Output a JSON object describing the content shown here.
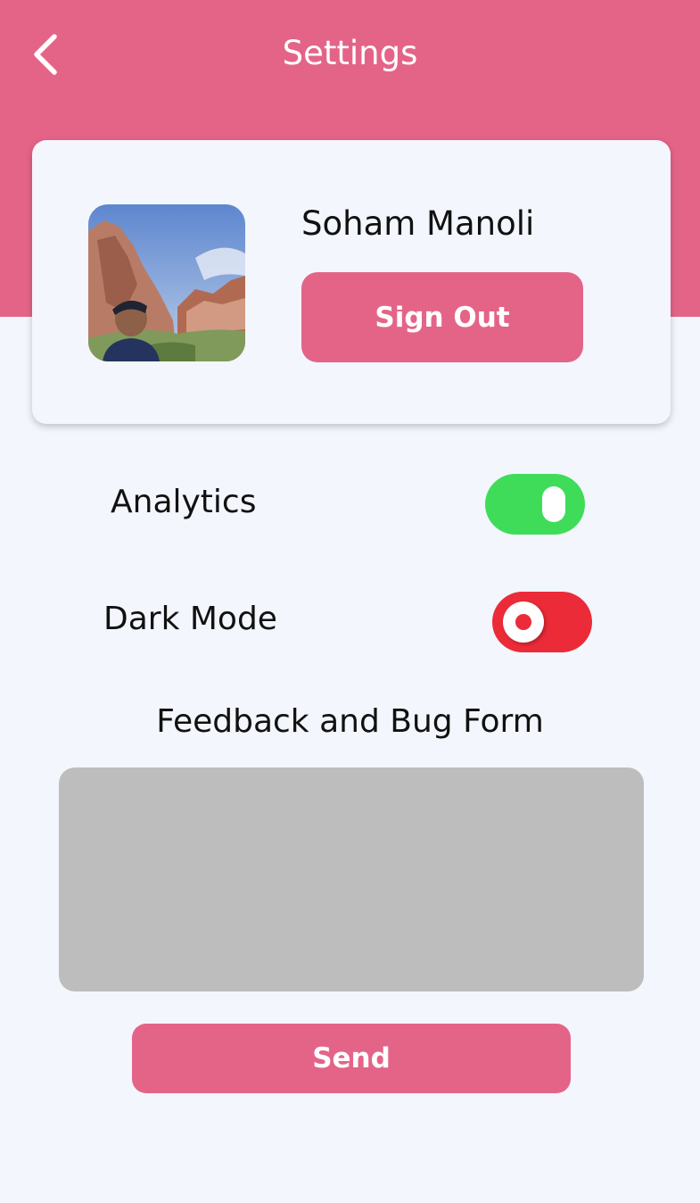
{
  "header": {
    "title": "Settings",
    "back_icon": "chevron-left-icon",
    "color": "#e46488"
  },
  "profile": {
    "name": "Soham Manoli",
    "sign_out_label": "Sign Out",
    "avatar": "profile-photo"
  },
  "settings": [
    {
      "label": "Analytics",
      "enabled": true,
      "color": "#3fdc5a"
    },
    {
      "label": "Dark Mode",
      "enabled": false,
      "color": "#ec2b38"
    }
  ],
  "feedback": {
    "title": "Feedback and Bug Form",
    "value": "",
    "send_label": "Send"
  }
}
